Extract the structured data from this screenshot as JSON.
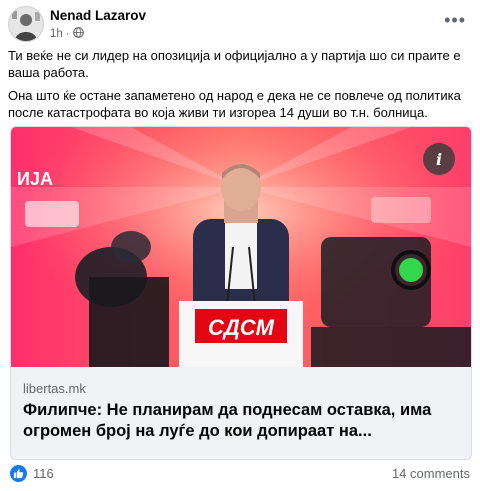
{
  "post": {
    "author": "Nenad Lazarov",
    "time": "1h",
    "visibility_icon": "globe-icon",
    "more_icon": "more-options-icon",
    "paragraphs": [
      "Ти веќе не си лидер на опозиција и официјално а у партија шо си праите е ваша работа.",
      "Она што ќе остане запаметено од народ е дека не се повлече од политика после катастрофата во која живи ти изгореа 14 души во т.н. болница."
    ]
  },
  "link_preview": {
    "image_logo_text": "СДСМ",
    "image_side_text": "ИЈА",
    "info_icon": "info-icon",
    "info_glyph": "i",
    "domain": "libertas.mk",
    "headline": "Филипче: Не планирам да поднесам оставка, има огромен број на луѓе до кои допираат на..."
  },
  "reactions": {
    "icon": "like-icon",
    "count": "116",
    "comments": "14 comments"
  },
  "colors": {
    "like_blue": "#1877f2",
    "secondary_text": "#65676b",
    "sdsm_red": "#e30613",
    "backdrop_pink": "#ff4d5e"
  }
}
